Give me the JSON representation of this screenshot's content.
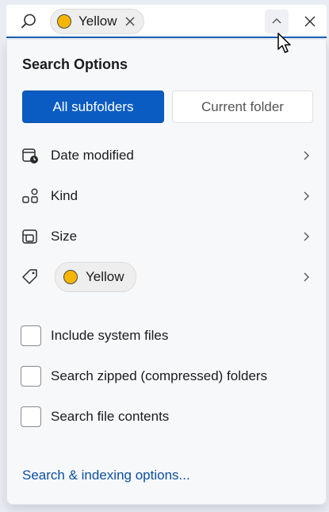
{
  "search_bar": {
    "chip": {
      "label": "Yellow",
      "color": "#f7b500"
    },
    "icons": {
      "search": "search-icon",
      "chip_remove": "close-icon",
      "collapse": "chevron-up-icon",
      "close": "close-icon"
    }
  },
  "panel": {
    "heading": "Search Options",
    "scope": {
      "active": "All subfolders",
      "inactive": "Current folder"
    },
    "filters": [
      {
        "label": "Date modified",
        "icon": "calendar-clock-icon"
      },
      {
        "label": "Kind",
        "icon": "kind-grid-icon"
      },
      {
        "label": "Size",
        "icon": "size-icon"
      }
    ],
    "tag_filter": {
      "icon": "tag-icon",
      "chip_label": "Yellow",
      "chip_color": "#f7b500"
    },
    "checkboxes": [
      {
        "label": "Include system files",
        "checked": false
      },
      {
        "label": "Search zipped (compressed) folders",
        "checked": false
      },
      {
        "label": "Search file contents",
        "checked": false
      }
    ],
    "link": "Search & indexing options..."
  },
  "colors": {
    "accent": "#0a5cc2",
    "link": "#0b4f9c",
    "focus_underline": "#1f5fb4"
  }
}
